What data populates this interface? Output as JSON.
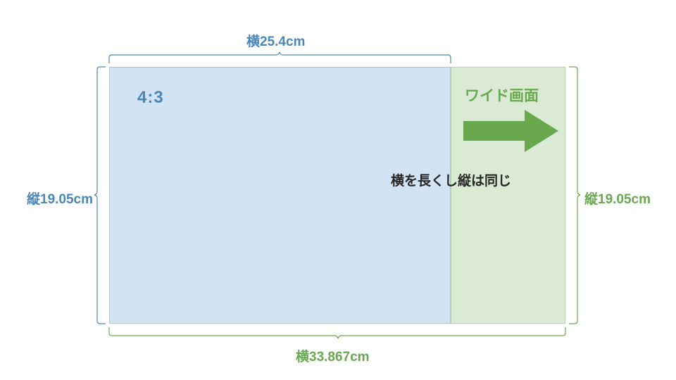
{
  "labels": {
    "ratio": "4:3",
    "wide": "ワイド画面",
    "desc": "横を長くし縦は同じ",
    "top": "横25.4cm",
    "left": "縦19.05cm",
    "right": "縦19.05cm",
    "bottom": "横33.867cm"
  },
  "colors": {
    "blue_fill": "#d2e3f3",
    "blue_line": "#4a86b8",
    "green_fill": "#dbead5",
    "green_line": "#6aa84f",
    "arrow": "#6aa84f",
    "text_dark": "#262626"
  },
  "chart_data": {
    "type": "diagram",
    "title": "Aspect ratio comparison 4:3 vs Wide",
    "units": "cm",
    "shapes": [
      {
        "name": "4:3 screen",
        "width_cm": 25.4,
        "height_cm": 19.05,
        "color": "blue"
      },
      {
        "name": "Wide screen",
        "width_cm": 33.867,
        "height_cm": 19.05,
        "color": "green"
      }
    ],
    "annotations": [
      {
        "side": "top",
        "text": "横25.4cm",
        "refers_to": "4:3 width"
      },
      {
        "side": "left",
        "text": "縦19.05cm",
        "refers_to": "4:3 height"
      },
      {
        "side": "right",
        "text": "縦19.05cm",
        "refers_to": "Wide height"
      },
      {
        "side": "bottom",
        "text": "横33.867cm",
        "refers_to": "Wide width"
      },
      {
        "inside": "green",
        "text": "ワイド画面"
      },
      {
        "inside": "blue",
        "text": "4:3"
      },
      {
        "near_arrow": true,
        "text": "横を長くし縦は同じ"
      }
    ]
  }
}
